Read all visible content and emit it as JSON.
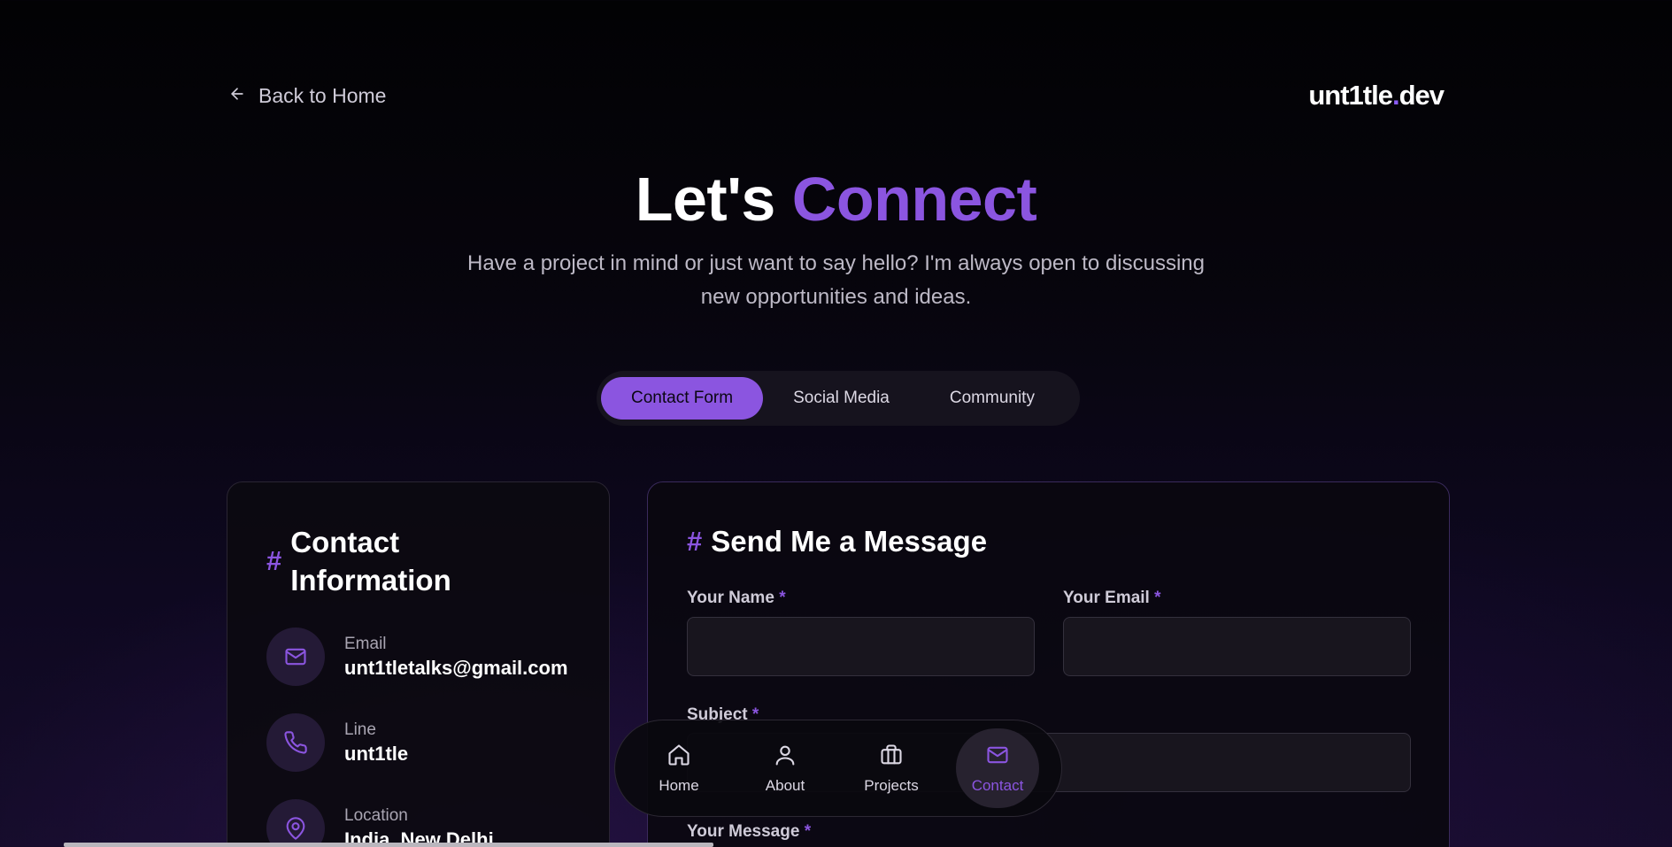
{
  "header": {
    "back_label": "Back to Home",
    "brand_main": "unt1tle",
    "brand_dot": ".",
    "brand_tld": "dev"
  },
  "hero": {
    "title_plain": "Let's",
    "title_accent": "Connect",
    "subtitle_line1": "Have a project in mind or just want to say hello? I'm always open to discussing",
    "subtitle_line2": "new opportunities and ideas."
  },
  "tabs": [
    {
      "label": "Contact Form",
      "active": true
    },
    {
      "label": "Social Media",
      "active": false
    },
    {
      "label": "Community",
      "active": false
    }
  ],
  "contact_info": {
    "hash": "#",
    "title": "Contact Information",
    "items": [
      {
        "label": "Email",
        "value": "unt1tletalks@gmail.com",
        "icon": "mail-icon"
      },
      {
        "label": "Line",
        "value": "unt1tle",
        "icon": "phone-icon"
      },
      {
        "label": "Location",
        "value": "India, New Delhi",
        "icon": "map-pin-icon"
      }
    ]
  },
  "form": {
    "hash": "#",
    "title": "Send Me a Message",
    "required_mark": "*",
    "name_label": "Your Name",
    "email_label": "Your Email",
    "subject_label": "Subject",
    "message_label": "Your Message",
    "name_value": "",
    "email_value": "",
    "subject_value": ""
  },
  "dock": [
    {
      "label": "Home",
      "icon": "home-icon",
      "active": false
    },
    {
      "label": "About",
      "icon": "user-icon",
      "active": false
    },
    {
      "label": "Projects",
      "icon": "briefcase-icon",
      "active": false
    },
    {
      "label": "Contact",
      "icon": "mail-icon",
      "active": true
    }
  ],
  "colors": {
    "accent": "#8b55e0",
    "background": "#07050d",
    "card": "#0c0a10"
  }
}
